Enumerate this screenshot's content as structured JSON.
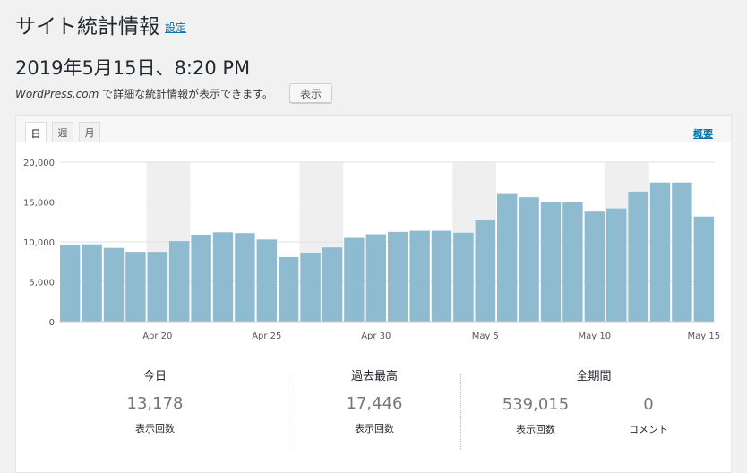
{
  "header": {
    "title": "サイト統計情報",
    "settings_link": "設定",
    "datetime": "2019年5月15日、8:20 PM",
    "note_brand": "WordPress.com",
    "note_text": " で詳細な統計情報が表示できます。",
    "show_button": "表示"
  },
  "tabs": [
    {
      "label": "日",
      "active": true
    },
    {
      "label": "週",
      "active": false
    },
    {
      "label": "月",
      "active": false
    }
  ],
  "overview_link": "概要",
  "chart_data": {
    "type": "bar",
    "ylim": [
      0,
      20000
    ],
    "yticks": [
      0,
      5000,
      10000,
      15000,
      20000
    ],
    "ytick_labels": [
      "0",
      "5,000",
      "10,000",
      "15,000",
      "20,000"
    ],
    "categories": [
      "Apr 16",
      "Apr 17",
      "Apr 18",
      "Apr 19",
      "Apr 20",
      "Apr 21",
      "Apr 22",
      "Apr 23",
      "Apr 24",
      "Apr 25",
      "Apr 26",
      "Apr 27",
      "Apr 28",
      "Apr 29",
      "Apr 30",
      "May 1",
      "May 2",
      "May 3",
      "May 4",
      "May 5",
      "May 6",
      "May 7",
      "May 8",
      "May 9",
      "May 10",
      "May 11",
      "May 12",
      "May 13",
      "May 14",
      "May 15"
    ],
    "xtick_labels": [
      {
        "index": 4,
        "label": "Apr 20"
      },
      {
        "index": 9,
        "label": "Apr 25"
      },
      {
        "index": 14,
        "label": "Apr 30"
      },
      {
        "index": 19,
        "label": "May 5"
      },
      {
        "index": 24,
        "label": "May 10"
      },
      {
        "index": 29,
        "label": "May 15"
      }
    ],
    "values": [
      9600,
      9700,
      9250,
      8750,
      8750,
      10100,
      10900,
      11200,
      11100,
      10300,
      8100,
      8650,
      9300,
      10500,
      10950,
      11250,
      11400,
      11400,
      11150,
      12700,
      16000,
      15600,
      15050,
      14950,
      13800,
      14200,
      16300,
      17446,
      17446,
      13178
    ],
    "weekend_bands": [
      [
        4,
        5
      ],
      [
        11,
        12
      ],
      [
        18,
        19
      ],
      [
        25,
        26
      ]
    ],
    "bar_color": "#8ebbd0",
    "band_color": "#efefef"
  },
  "stats": {
    "today": {
      "label": "今日",
      "value": "13,178",
      "sub": "表示回数"
    },
    "best": {
      "label": "過去最高",
      "value": "17,446",
      "sub": "表示回数"
    },
    "all_time": {
      "label": "全期間",
      "views": "539,015",
      "views_sub": "表示回数",
      "comments": "0",
      "comments_sub": "コメント"
    }
  }
}
